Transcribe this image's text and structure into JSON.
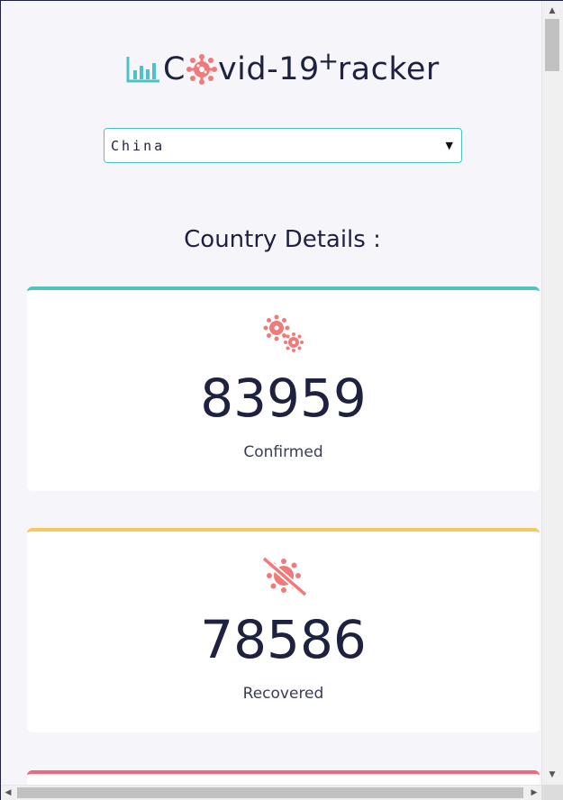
{
  "header": {
    "logo_prefix": "C",
    "logo_suffix": "vid-19",
    "logo_plus": "+",
    "logo_tail": "racker",
    "logo_icon": "bar-chart-icon",
    "virus_icon": "virus-icon"
  },
  "country_select": {
    "selected": "China",
    "arrow": "▼"
  },
  "section": {
    "title": "Country Details :"
  },
  "cards": {
    "confirmed": {
      "count": "83959",
      "label": "Confirmed",
      "icon": "virus-cluster-icon",
      "accent": "#4fc3c3"
    },
    "recovered": {
      "count": "78586",
      "label": "Recovered",
      "icon": "virus-crossed-icon",
      "accent": "#f5c860"
    },
    "deaths": {
      "accent": "#ee6a7c"
    }
  },
  "colors": {
    "background": "#f5f5fa",
    "text": "#1e2140",
    "virus": "#f07a7a",
    "teal": "#4fc3c3"
  },
  "scrollbars": {
    "up_arrow": "▲",
    "down_arrow": "▼",
    "left_arrow": "◀",
    "right_arrow": "▶"
  }
}
